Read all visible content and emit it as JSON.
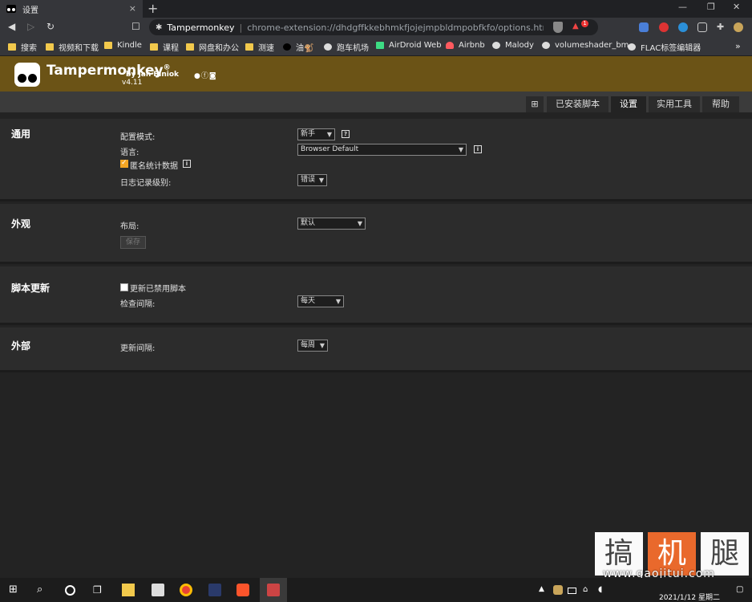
{
  "browser": {
    "tab_title": "设置",
    "tab_close": "×",
    "new_tab": "+",
    "win_min": "—",
    "win_max": "❐",
    "win_close": "✕",
    "site_name": "Tampermonkey",
    "url": "chrome-extension://dhdgffkkebhmkfjojejmpbldmpobfkfo/options.html#na...",
    "ext_badge": "1",
    "bookmarks_more": "»"
  },
  "bookmarks": [
    {
      "label": "搜索",
      "icon": "folder"
    },
    {
      "label": "视频和下载",
      "icon": "folder"
    },
    {
      "label": "Kindle",
      "icon": "folder"
    },
    {
      "label": "课程",
      "icon": "folder"
    },
    {
      "label": "网盘和办公",
      "icon": "folder"
    },
    {
      "label": "测速",
      "icon": "folder"
    },
    {
      "label": "油🐒",
      "icon": "tampermonkey"
    },
    {
      "label": "跑车机场",
      "icon": "globe"
    },
    {
      "label": "AirDroid Web",
      "icon": "airdroid"
    },
    {
      "label": "Airbnb",
      "icon": "airbnb"
    },
    {
      "label": "Malody",
      "icon": "globe"
    },
    {
      "label": "volumeshader_bm",
      "icon": "globe"
    },
    {
      "label": "FLAC标签编辑器",
      "icon": "globe"
    }
  ],
  "header": {
    "title": "Tampermonkey",
    "registered": "®",
    "by": "by Jan Biniok",
    "version": "v4.11"
  },
  "tabs": {
    "add": "⊞",
    "installed": "已安装脚本",
    "settings": "设置",
    "utilities": "实用工具",
    "help": "帮助"
  },
  "general": {
    "title": "通用",
    "config_mode_label": "配置模式:",
    "config_mode_value": "新手",
    "language_label": "语言:",
    "language_value": "Browser Default",
    "anon_stats_label": "匿名统计数据",
    "log_level_label": "日志记录级别:",
    "log_level_value": "错误"
  },
  "appearance": {
    "title": "外观",
    "layout_label": "布局:",
    "layout_value": "默认",
    "save_label": "保存"
  },
  "script_update": {
    "title": "脚本更新",
    "update_disabled_label": "更新已禁用脚本",
    "check_interval_label": "检查间隔:",
    "check_interval_value": "每天"
  },
  "external": {
    "title": "外部",
    "update_interval_label": "更新间隔:",
    "update_interval_value": "每周"
  },
  "watermark": {
    "char1": "搞",
    "char2": "机",
    "char3": "腿",
    "url": "www.gaojitui.com"
  },
  "taskbar": {
    "clock": "2021/1/12 星期二"
  }
}
